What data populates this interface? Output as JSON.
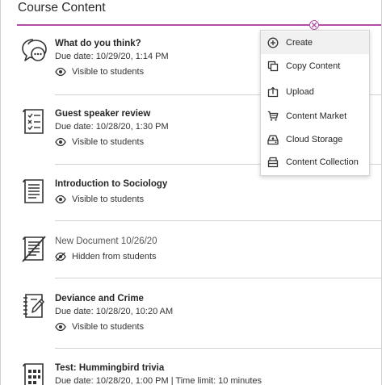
{
  "page": {
    "title": "Course Content"
  },
  "items": [
    {
      "title": "What do you think?",
      "due": "Due date: 10/29/20, 1:14 PM",
      "visibility": "Visible to students",
      "icon": "discussion-icon"
    },
    {
      "title": "Guest speaker review",
      "due": "Due date: 10/28/20, 1:30 PM",
      "visibility": "Visible to students",
      "icon": "assignment-icon"
    },
    {
      "title": "Introduction to Sociology",
      "due": "",
      "visibility": "Visible to students",
      "icon": "document-icon"
    },
    {
      "title": "New Document 10/26/20",
      "due": "",
      "visibility": "Hidden from students",
      "icon": "hidden-document-icon"
    },
    {
      "title": "Deviance and Crime",
      "due": "Due date: 10/28/20, 10:20 AM",
      "visibility": "Visible to students",
      "icon": "journal-icon"
    },
    {
      "title": "Test: Hummingbird trivia",
      "due": "Due date: 10/28/20, 1:00 PM | Time limit: 10 minutes",
      "visibility": "",
      "icon": "test-icon"
    }
  ],
  "menu": {
    "items": [
      {
        "label": "Create",
        "icon": "plus-circle-icon"
      },
      {
        "label": "Copy Content",
        "icon": "copy-icon"
      },
      {
        "label": "Upload",
        "icon": "upload-icon"
      },
      {
        "label": "Content Market",
        "icon": "cart-icon"
      },
      {
        "label": "Cloud Storage",
        "icon": "cloud-storage-icon"
      },
      {
        "label": "Content Collection",
        "icon": "collection-icon"
      }
    ]
  },
  "colors": {
    "accent": "#b24ea8",
    "separator": "#d2d2d2",
    "text": "#262626"
  }
}
